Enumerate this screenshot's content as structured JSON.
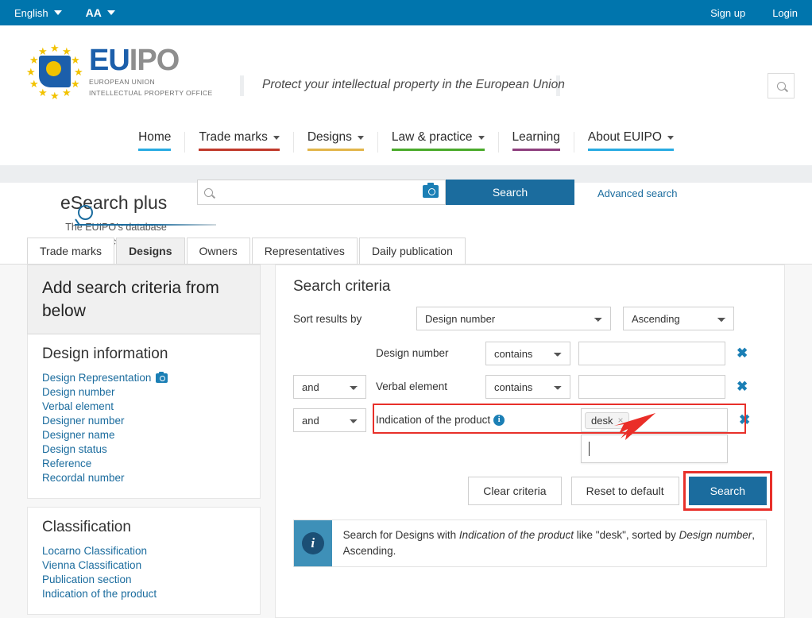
{
  "topbar": {
    "language": "English",
    "fontsize": "AA",
    "signup": "Sign up",
    "login": "Login"
  },
  "header": {
    "logo_eu": "EU",
    "logo_ipo": "IPO",
    "logo_sub_line1": "EUROPEAN UNION",
    "logo_sub_line2": "INTELLECTUAL PROPERTY OFFICE",
    "tagline": "Protect your intellectual property in the European Union"
  },
  "nav": {
    "items": [
      {
        "label": "Home",
        "caret": false,
        "color": "#29abe2"
      },
      {
        "label": "Trade marks",
        "caret": true,
        "color": "#c0392b"
      },
      {
        "label": "Designs",
        "caret": true,
        "color": "#e2b54a"
      },
      {
        "label": "Law & practice",
        "caret": true,
        "color": "#4aaa2b"
      },
      {
        "label": "Learning",
        "caret": false,
        "color": "#8e3f7e"
      },
      {
        "label": "About EUIPO",
        "caret": true,
        "color": "#29abe2"
      }
    ]
  },
  "esearch": {
    "title": "eSearch plus",
    "subtitle": "The EUIPO’s database",
    "subtitle2": "access",
    "search_value": "",
    "search_placeholder": "",
    "search_button": "Search",
    "advanced_link": "Advanced search"
  },
  "tabs": [
    {
      "label": "Trade marks",
      "active": false
    },
    {
      "label": "Designs",
      "active": true
    },
    {
      "label": "Owners",
      "active": false
    },
    {
      "label": "Representatives",
      "active": false
    },
    {
      "label": "Daily publication",
      "active": false
    }
  ],
  "sidebar": {
    "heading": "Add search criteria from below",
    "sections": [
      {
        "title": "Design information",
        "links": [
          {
            "label": "Design Representation",
            "icon": "camera-icon"
          },
          {
            "label": "Design number",
            "icon": null
          },
          {
            "label": "Verbal element",
            "icon": null
          },
          {
            "label": "Designer number",
            "icon": null
          },
          {
            "label": "Designer name",
            "icon": null
          },
          {
            "label": "Design status",
            "icon": null
          },
          {
            "label": "Reference",
            "icon": null
          },
          {
            "label": "Recordal number",
            "icon": null
          }
        ]
      },
      {
        "title": "Classification",
        "links": [
          {
            "label": "Locarno Classification",
            "icon": null
          },
          {
            "label": "Vienna Classification",
            "icon": null
          },
          {
            "label": "Publication section",
            "icon": null
          },
          {
            "label": "Indication of the product",
            "icon": null
          }
        ]
      }
    ]
  },
  "main": {
    "title": "Search criteria",
    "sort_label": "Sort results by",
    "sort_field": "Design number",
    "sort_order": "Ascending",
    "criteria": [
      {
        "conjunction": null,
        "field": "Design number",
        "operator": "contains",
        "value": "",
        "delete": "✖"
      },
      {
        "conjunction": "and",
        "field": "Verbal element",
        "operator": "contains",
        "value": "",
        "delete": "✖"
      },
      {
        "conjunction": "and",
        "field": "Indication of the product",
        "operator": null,
        "value": "",
        "tag": "desk",
        "tag_remove": "×",
        "delete": "✖",
        "info_icon": "i",
        "highlighted": true
      }
    ],
    "buttons": {
      "clear": "Clear criteria",
      "reset": "Reset to default",
      "search": "Search"
    },
    "info": {
      "icon": "i",
      "prefix": "Search for Designs with ",
      "field": "Indication of the product",
      "mid": " like \"desk\", sorted by ",
      "sortfield": "Design number",
      "suffix": ", Ascending."
    }
  },
  "annotation": {
    "arrow_color": "#ea2e28",
    "highlight_color": "#e8302a"
  }
}
